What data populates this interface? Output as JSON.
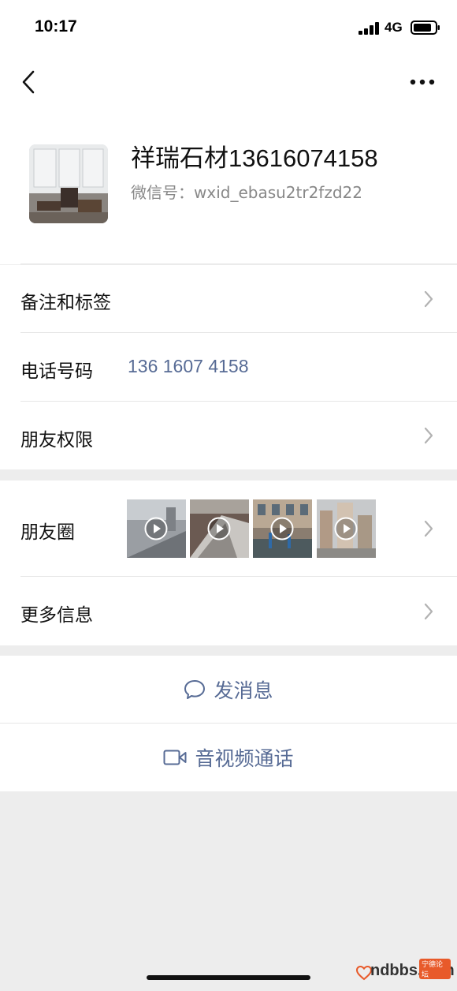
{
  "status_bar": {
    "time": "10:17",
    "network": "4G"
  },
  "profile": {
    "name": "祥瑞石材13616074158",
    "wechat_id": "微信号：wxid_ebasu2tr2fzd22"
  },
  "rows": {
    "remarks_tags": "备注和标签",
    "phone_label": "电话号码",
    "phone_value": "136 1607 4158",
    "friend_permissions": "朋友权限",
    "moments": "朋友圈",
    "more_info": "更多信息"
  },
  "actions": {
    "send_message": "发消息",
    "video_call": "音视频通话"
  },
  "watermark": {
    "brand": "ndbbs.com",
    "tag": "宁德论坛"
  },
  "colors": {
    "link": "#576b95",
    "background": "#ededed"
  }
}
